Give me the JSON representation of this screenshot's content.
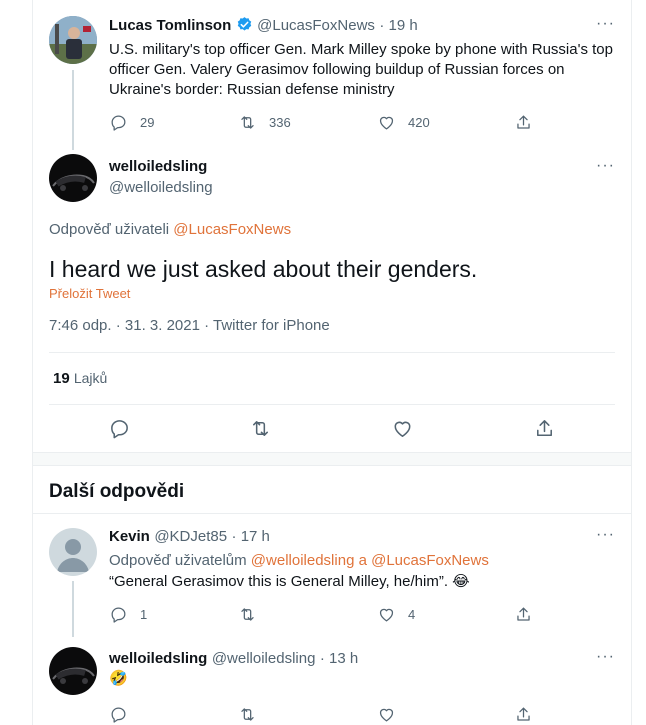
{
  "tweet1": {
    "name": "Lucas Tomlinson",
    "handle": "@LucasFoxNews",
    "time": "· 19 h",
    "more": "···",
    "text": "U.S. military's top officer Gen. Mark Milley spoke by phone with Russia's top officer Gen. Valery Gerasimov following buildup of Russian forces on Ukraine's border: Russian defense ministry",
    "replies": "29",
    "retweets": "336",
    "likes": "420"
  },
  "main_tweet": {
    "name": "welloiledsling",
    "handle": "@welloiledsling",
    "more": "···",
    "reply_prefix": "Odpověď uživateli",
    "reply_to": "@LucasFoxNews",
    "text": "I heard we just asked about their genders.",
    "translate": "Přeložit Tweet",
    "meta": "7:46 odp. · 31. 3. 2021 · Twitter for iPhone",
    "likes_count": "19",
    "likes_label": "Lajků"
  },
  "section": {
    "title": "Další odpovědi"
  },
  "reply1": {
    "name": "Kevin",
    "handle": "@KDJet85",
    "time": "· 17 h",
    "more": "···",
    "reply_prefix": "Odpověď uživatelům",
    "reply_to_1": "@welloiledsling",
    "reply_and": "a",
    "reply_to_2": "@LucasFoxNews",
    "text": "“General Gerasimov this is General Milley, he/him”. 😂",
    "replies": "1",
    "retweets": "",
    "likes": "4"
  },
  "reply2": {
    "name": "welloiledsling",
    "handle": "@welloiledsling",
    "time": "· 13 h",
    "more": "···",
    "text": "🤣"
  },
  "colors": {
    "accent": "#e0733a",
    "verified": "#1d9bf0",
    "muted": "#536471"
  },
  "icons": [
    "reply-icon",
    "retweet-icon",
    "like-icon",
    "share-icon",
    "verified-badge-icon",
    "more-icon"
  ]
}
